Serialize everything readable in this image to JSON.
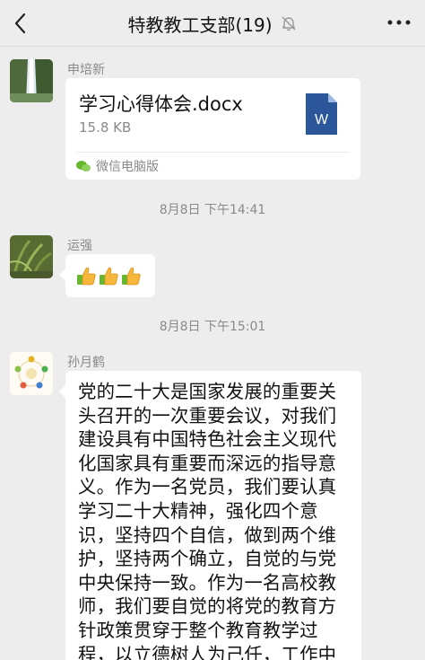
{
  "header": {
    "title": "特教教工支部(19)",
    "back_icon": "chevron-left-icon",
    "mute_icon": "bell-off-icon",
    "more_icon": "more-horizontal-icon"
  },
  "messages": [
    {
      "sender": "申培新",
      "avatar": "waterfall-avatar",
      "file": {
        "name": "学习心得体会.docx",
        "size": "15.8 KB",
        "icon": "word-document-icon",
        "source": "微信电脑版"
      }
    },
    {
      "timestamp": "8月8日 下午14:41"
    },
    {
      "sender": "运强",
      "avatar": "plant-avatar",
      "emoji": [
        "thumbs-up",
        "thumbs-up",
        "thumbs-up"
      ]
    },
    {
      "timestamp": "8月8日 下午15:01"
    },
    {
      "sender": "孙月鹤",
      "avatar": "diagram-avatar",
      "text": "党的二十大是国家发展的重要关头召开的一次重要会议，对我们建设具有中国特色社会主义现代化国家具有重要而深远的指导意义。作为一名党员，我们要认真学习二十大精神，强化四个意识，坚持四个自信，做到两个维护，坚持两个确立，自觉的与党中央保持一致。作为一名高校教师，我们要自觉的将党的教育方针政策贯穿于整个教育教学过程，以立德树人为己任，工作中坚持两个结合，争取做四有好"
    }
  ],
  "colors": {
    "background": "#ededed",
    "bubble": "#ffffff",
    "word_blue": "#2b579a",
    "emoji_yellow": "#f6b73c",
    "cuff_green": "#67b82f"
  }
}
